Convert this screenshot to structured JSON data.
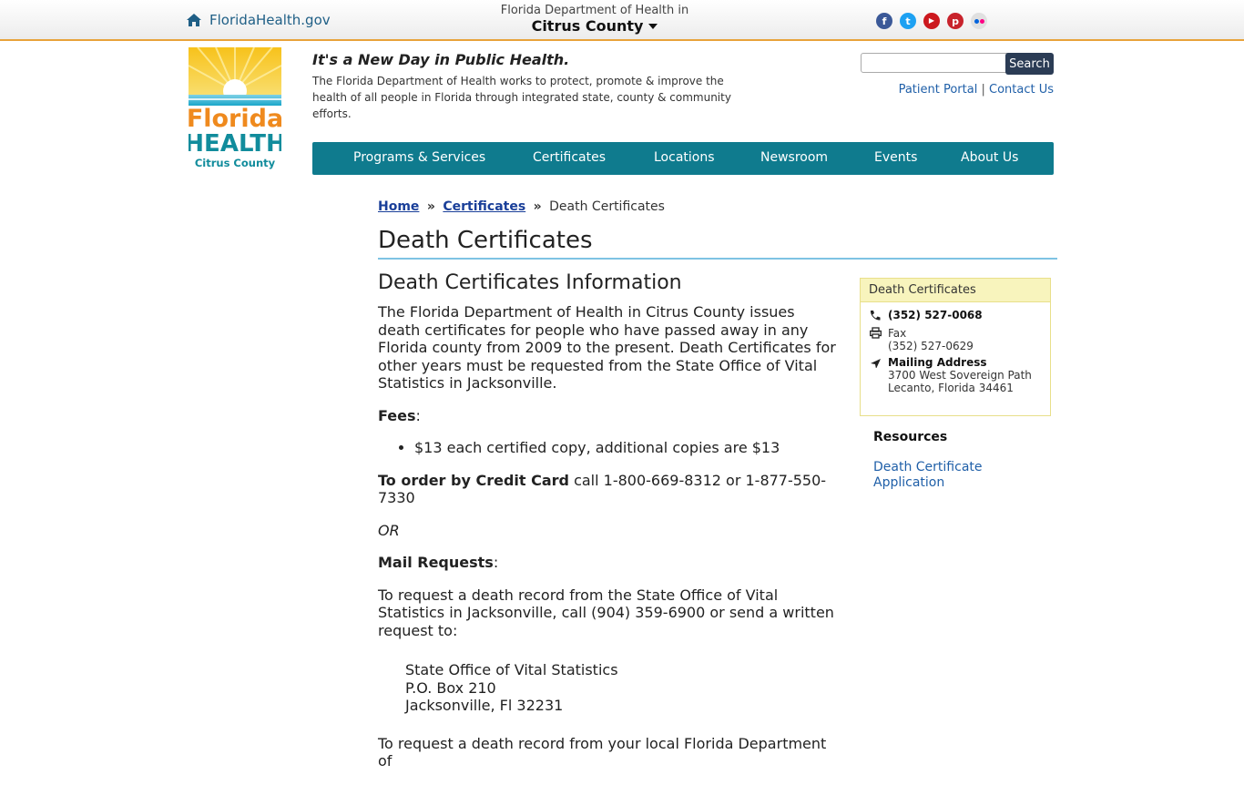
{
  "topbar": {
    "home_label": "FloridaHealth.gov",
    "dept_label": "Florida Department of Health in",
    "county_label": "Citrus County",
    "social": [
      "facebook-icon",
      "twitter-icon",
      "youtube-icon",
      "pinterest-icon",
      "flickr-icon"
    ]
  },
  "header": {
    "logo_line1": "Florida",
    "logo_line2": "HEALTH",
    "logo_line3": "Citrus County",
    "tagline": "It's a New Day in Public Health.",
    "mission": "The Florida Department of Health works to protect, promote & improve the health of all people in Florida through integrated state, county & community efforts.",
    "search_placeholder": "",
    "search_button": "Search",
    "patient_portal": "Patient Portal",
    "divider": "|",
    "contact_us": "Contact Us"
  },
  "nav": [
    {
      "label": "Programs & Services"
    },
    {
      "label": "Certificates"
    },
    {
      "label": "Locations"
    },
    {
      "label": "Newsroom"
    },
    {
      "label": "Events"
    },
    {
      "label": "About Us"
    }
  ],
  "breadcrumb": {
    "home": "Home",
    "certificates": "Certificates",
    "current": "Death Certificates",
    "separator": "»"
  },
  "page": {
    "title": "Death Certificates",
    "section_title": "Death Certificates Information",
    "intro": "The Florida Department of Health in Citrus County issues death certificates for people who have passed away in any Florida county from 2009 to the present. Death Certificates for other years must be requested from the State Office of Vital Statistics in Jacksonville.",
    "fees_label": "Fees",
    "fees_items": [
      "$13 each certified copy, additional copies are $13"
    ],
    "credit_label": "To order by Credit Card",
    "credit_text": " call 1-800-669-8312 or 1-877-550-7330",
    "or_text": "OR",
    "mail_label": "Mail Requests",
    "mail_text": "To request a death record from the State Office of Vital Statistics in Jacksonville, call (904) 359-6900 or send a written request to:",
    "address_line1": "State Office of Vital Statistics",
    "address_line2": "P.O. Box 210",
    "address_line3": "Jacksonville, Fl 32231",
    "trailing_text": "To request a death record from your local Florida Department of"
  },
  "sidebar": {
    "card_title": "Death Certificates",
    "phone": "(352) 527-0068",
    "fax_label": "Fax",
    "fax": "(352) 527-0629",
    "mail_label": "Mailing Address",
    "mail_line1": "3700 West Sovereign Path",
    "mail_line2": "Lecanto, Florida 34461",
    "resources_title": "Resources",
    "resource_link": "Death Certificate Application"
  },
  "colors": {
    "nav_bg": "#0f7b8e",
    "topbar_border": "#e8a33a",
    "link": "#1f5fa8",
    "search_button_bg": "#2b3c55"
  }
}
